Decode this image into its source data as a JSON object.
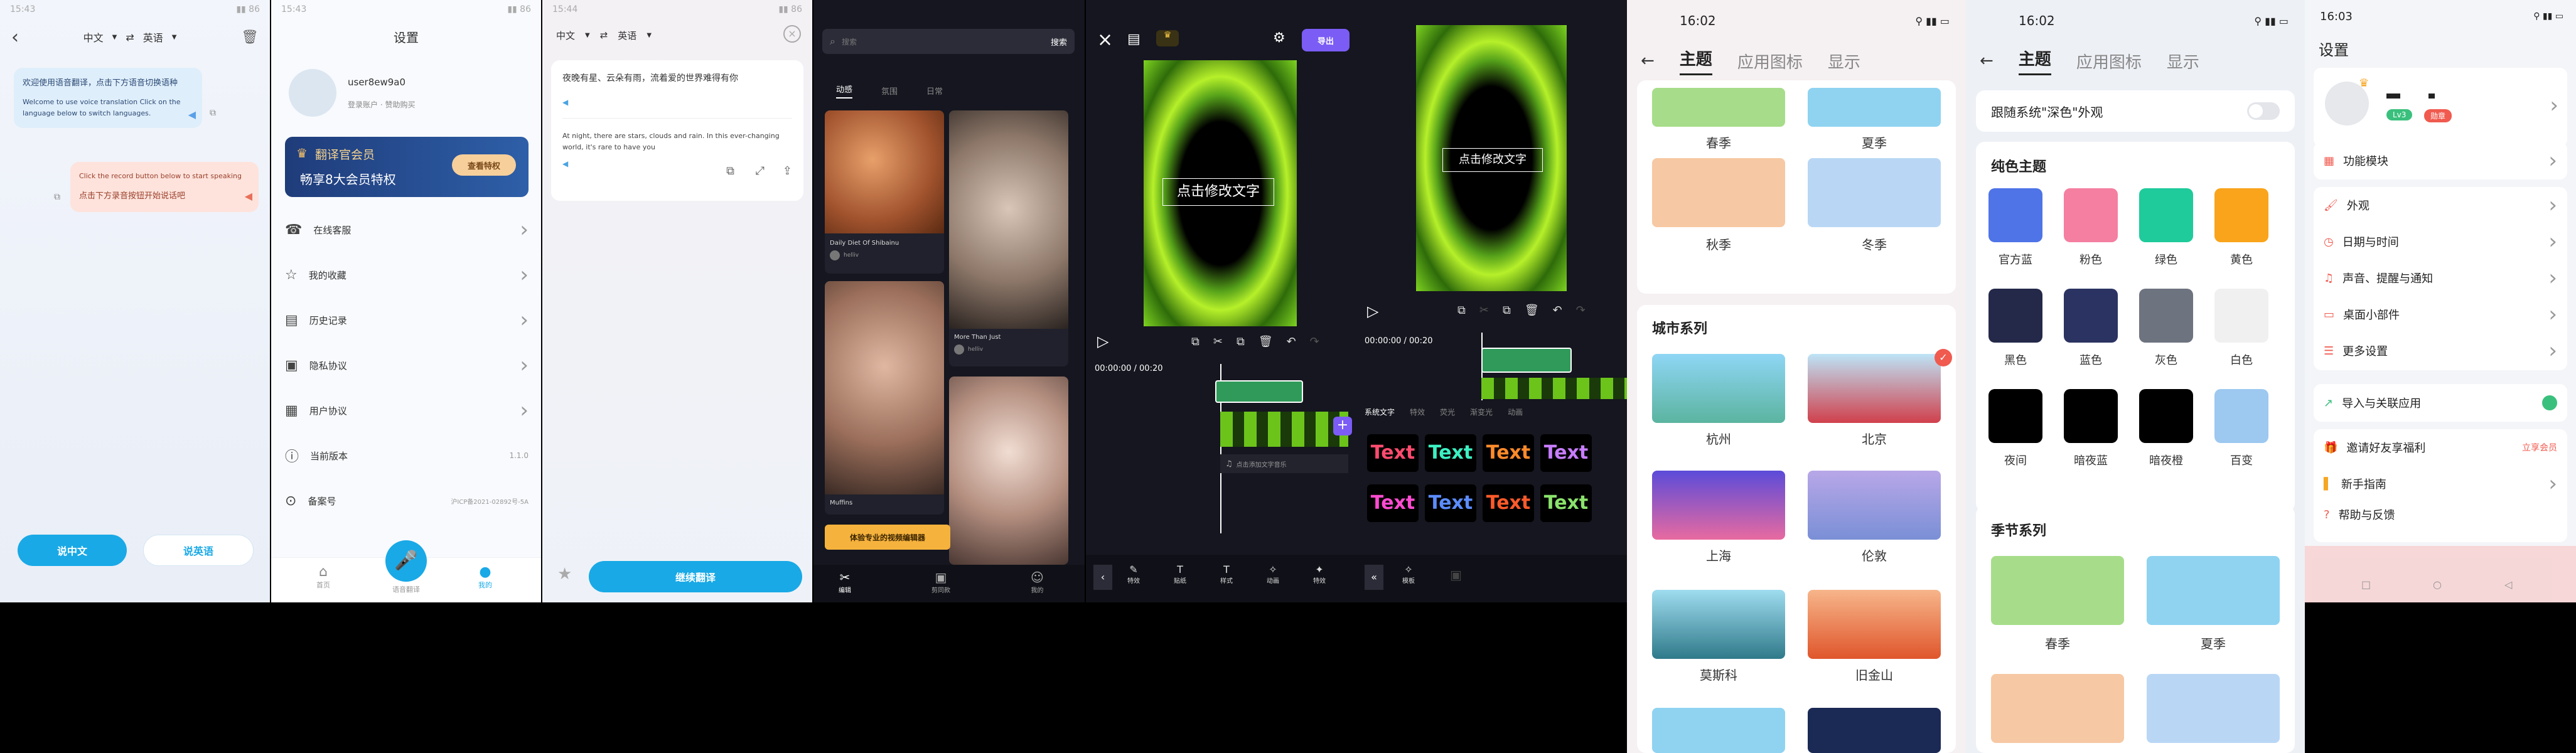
{
  "s1": {
    "lang_from": "中文",
    "lang_to": "英语",
    "bubble1_cn": "欢迎使用语音翻译，点击下方语音切换语种",
    "bubble1_en": "Welcome to use voice translation Click on the language below to switch languages.",
    "bubble2_en": "Click the record button below to start speaking",
    "bubble2_cn": "点击下方录音按钮开始说话吧",
    "btn_cn": "说中文",
    "btn_en": "说英语"
  },
  "s2": {
    "title": "设置",
    "username": "user8ew9a0",
    "user_sub": "登录账户 · 赞助购买",
    "vip_title": "翻译官会员",
    "vip_sub": "畅享8大会员特权",
    "vip_btn": "查看特权",
    "menu": [
      "在线客服",
      "我的收藏",
      "历史记录",
      "隐私协议",
      "用户协议",
      "当前版本",
      "备案号"
    ],
    "version": "1.1.0",
    "icp": "沪ICP备2021-02892号-5A",
    "nav": [
      "首页",
      "语音翻译",
      "我的"
    ]
  },
  "s3": {
    "lang_from": "中文",
    "lang_to": "英语",
    "cn_text": "夜晚有星、云朵有雨，流着爱的世界难得有你",
    "en_text": "At night, there are stars, clouds and rain. In this ever-changing world, it's rare to have you",
    "continue_btn": "继续翻译"
  },
  "s4": {
    "search_placeholder": "搜索",
    "search_btn": "搜索",
    "tabs": [
      "动感",
      "氛围",
      "日常"
    ],
    "cards": [
      "Daily Diet Of Shibainu",
      "More Than Just",
      "Muffins"
    ],
    "author": "helliv",
    "banner": "体验专业的视频编辑器",
    "nav": [
      "编辑",
      "剪同款",
      "我的"
    ]
  },
  "s5": {
    "export_btn": "导出",
    "overlay_text": "点击修改文字",
    "time": "00:00:00 / 00:20",
    "add_audio": "点击添加文字音乐",
    "tools": [
      "特效",
      "贴纸",
      "样式",
      "动画",
      "特效"
    ]
  },
  "s6": {
    "overlay_text": "点击修改文字",
    "time": "00:00:00 / 00:20",
    "style_tabs": [
      "系统文字",
      "特效",
      "荧光",
      "渐变光",
      "动画"
    ],
    "samples": [
      "Text",
      "Text",
      "Text",
      "Text",
      "Text",
      "Text",
      "Text",
      "Text"
    ],
    "bottom": [
      "模板"
    ]
  },
  "s7": {
    "time": "16:02",
    "tabs": [
      "主题",
      "应用图标",
      "显示"
    ],
    "season_top": [
      "春季",
      "夏季"
    ],
    "season_mid": [
      "秋季",
      "冬季"
    ],
    "city_section": "城市系列",
    "cities": [
      "杭州",
      "北京",
      "上海",
      "伦敦",
      "莫斯科",
      "旧金山"
    ],
    "colors": {
      "spring": "#a7dd8a",
      "summer": "#8fd3f1",
      "autumn": "#f6c8a3",
      "winter": "#b9d7f5"
    }
  },
  "s8": {
    "time": "16:02",
    "tabs": [
      "主题",
      "应用图标",
      "显示"
    ],
    "dark_follow": "跟随系统\"深色\"外观",
    "pure_section": "纯色主题",
    "pure": [
      {
        "name": "官方蓝",
        "color": "#4f74e8"
      },
      {
        "name": "粉色",
        "color": "#f47fa1"
      },
      {
        "name": "绿色",
        "color": "#1fcb9b"
      },
      {
        "name": "黄色",
        "color": "#f9a41a"
      },
      {
        "name": "黑色",
        "color": "#24294a"
      },
      {
        "name": "蓝色",
        "color": "#2b3362"
      },
      {
        "name": "灰色",
        "color": "#6e7380"
      },
      {
        "name": "白色",
        "color": "#f0f0f0"
      },
      {
        "name": "夜间",
        "color": "#000000"
      },
      {
        "name": "暗夜蓝",
        "color": "#000000"
      },
      {
        "name": "暗夜橙",
        "color": "#000000"
      },
      {
        "name": "百变",
        "color": "#9dc8f0"
      }
    ],
    "season_section": "季节系列",
    "seasons": [
      "春季",
      "夏季"
    ]
  },
  "s9": {
    "time": "16:03",
    "title": "设置",
    "level": "Lv3",
    "tag": "勋章",
    "items": [
      "功能模块",
      "外观",
      "日期与时间",
      "声音、提醒与通知",
      "桌面小部件",
      "更多设置",
      "导入与关联应用",
      "邀请好友享福利",
      "新手指南",
      "帮助与反馈"
    ],
    "vip_text": "立享会员"
  }
}
